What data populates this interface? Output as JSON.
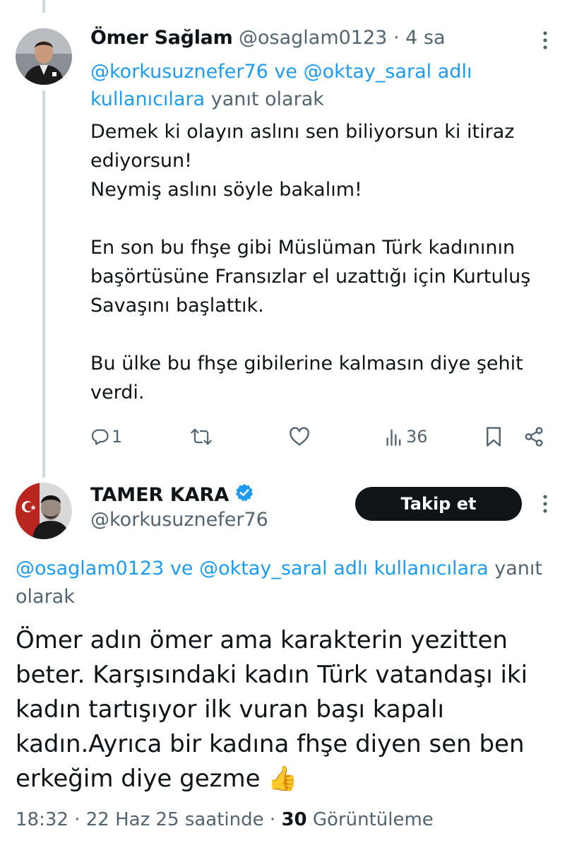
{
  "tweet1": {
    "display_name": "Ömer Sağlam",
    "handle": "@osaglam0123",
    "separator": "·",
    "time": "4 sa",
    "reply_mention1": "@korkusuznefer76",
    "reply_and": "ve",
    "reply_mention2": "@oktay_saral",
    "reply_link_suffix": "adlı kullanıcılara",
    "reply_suffix": "yanıt olarak",
    "body_lines": [
      "Demek ki olayın aslını sen biliyorsun ki itiraz ediyorsun!",
      "Neymiş aslını söyle bakalım!",
      "",
      "En son bu fhşe gibi Müslüman Türk kadınının başörtüsüne Fransızlar el uzattığı için Kurtuluş Savaşını başlattık.",
      "",
      "Bu ülke bu fhşe gibilerine kalmasın diye şehit verdi."
    ],
    "actions": {
      "reply_icon": "reply-icon",
      "reply_count": "1",
      "retweet_icon": "retweet-icon",
      "like_icon": "heart-icon",
      "views_icon": "views-icon",
      "views_count": "36",
      "bookmark_icon": "bookmark-icon",
      "share_icon": "share-icon"
    }
  },
  "tweet2": {
    "display_name": "TAMER KARA",
    "verified_icon": "verified-badge-icon",
    "handle": "@korkusuznefer76",
    "follow_label": "Takip et",
    "reply_mention1": "@osaglam0123",
    "reply_and": "ve",
    "reply_mention2": "@oktay_saral",
    "reply_link_suffix": "adlı kullanıcılara",
    "reply_suffix": "yanıt olarak",
    "body_lines": [
      "Ömer adın ömer ama karakterin yezitten beter. Karşısındaki kadın Türk vatandaşı iki kadın tartışıyor ilk vuran başı kapalı kadın.Ayrıca bir kadına fhşe diyen sen ben erkeğim diye gezme 👍"
    ],
    "time": "18:32",
    "separator": "·",
    "date": "22 Haz 25 saatinde",
    "views_count": "30",
    "views_label": "Görüntüleme"
  },
  "colors": {
    "accent": "#1d9bf0",
    "muted": "#536471",
    "text": "#0f1419",
    "thread_line": "#cfd9de"
  }
}
